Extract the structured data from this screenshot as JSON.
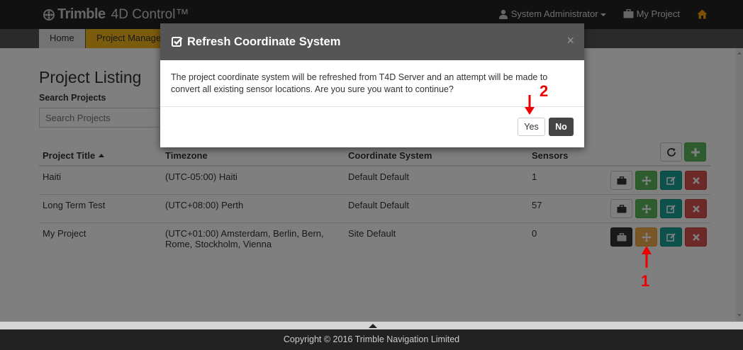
{
  "navbar": {
    "brand_name": "Trimble",
    "product_name": "4D Control™",
    "user_label": "System Administrator",
    "project_label": "My Project"
  },
  "tabs": [
    {
      "label": "Home"
    },
    {
      "label": "Project Manage"
    }
  ],
  "page": {
    "title": "Project Listing",
    "search_label": "Search Projects",
    "search_placeholder": "Search Projects"
  },
  "table": {
    "headers": [
      "Project Title",
      "Timezone",
      "Coordinate System",
      "Sensors"
    ],
    "rows": [
      {
        "title": "Haiti",
        "timezone": "(UTC-05:00) Haiti",
        "coordinate_system": "Default Default",
        "sensors": "1"
      },
      {
        "title": "Long Term Test",
        "timezone": "(UTC+08:00) Perth",
        "coordinate_system": "Default Default",
        "sensors": "57"
      },
      {
        "title": "My Project",
        "timezone": "(UTC+01:00) Amsterdam, Berlin, Bern, Rome, Stockholm, Vienna",
        "coordinate_system": "Site Default",
        "sensors": "0"
      }
    ]
  },
  "modal": {
    "title": "Refresh Coordinate System",
    "close": "×",
    "body": "The project coordinate system will be refreshed from T4D Server and an attempt will be made to convert all existing sensor locations. Are you sure you want to continue?",
    "yes_label": "Yes",
    "no_label": "No"
  },
  "annotations": {
    "step1": "1",
    "step2": "2"
  },
  "footer": {
    "text": "Copyright © 2016 Trimble Navigation Limited"
  },
  "colors": {
    "accent_tab": "#f7b718",
    "success": "#5cb85c",
    "warning": "#f0ad4e",
    "teal": "#1aa39a",
    "danger": "#d9534f",
    "annotation": "#ee0000"
  },
  "icons": [
    "trimble-logo-icon",
    "user-icon",
    "briefcase-icon",
    "home-icon",
    "refresh-icon",
    "plus-icon",
    "move-icon",
    "edit-icon",
    "delete-icon",
    "check-square-icon",
    "close-icon"
  ]
}
